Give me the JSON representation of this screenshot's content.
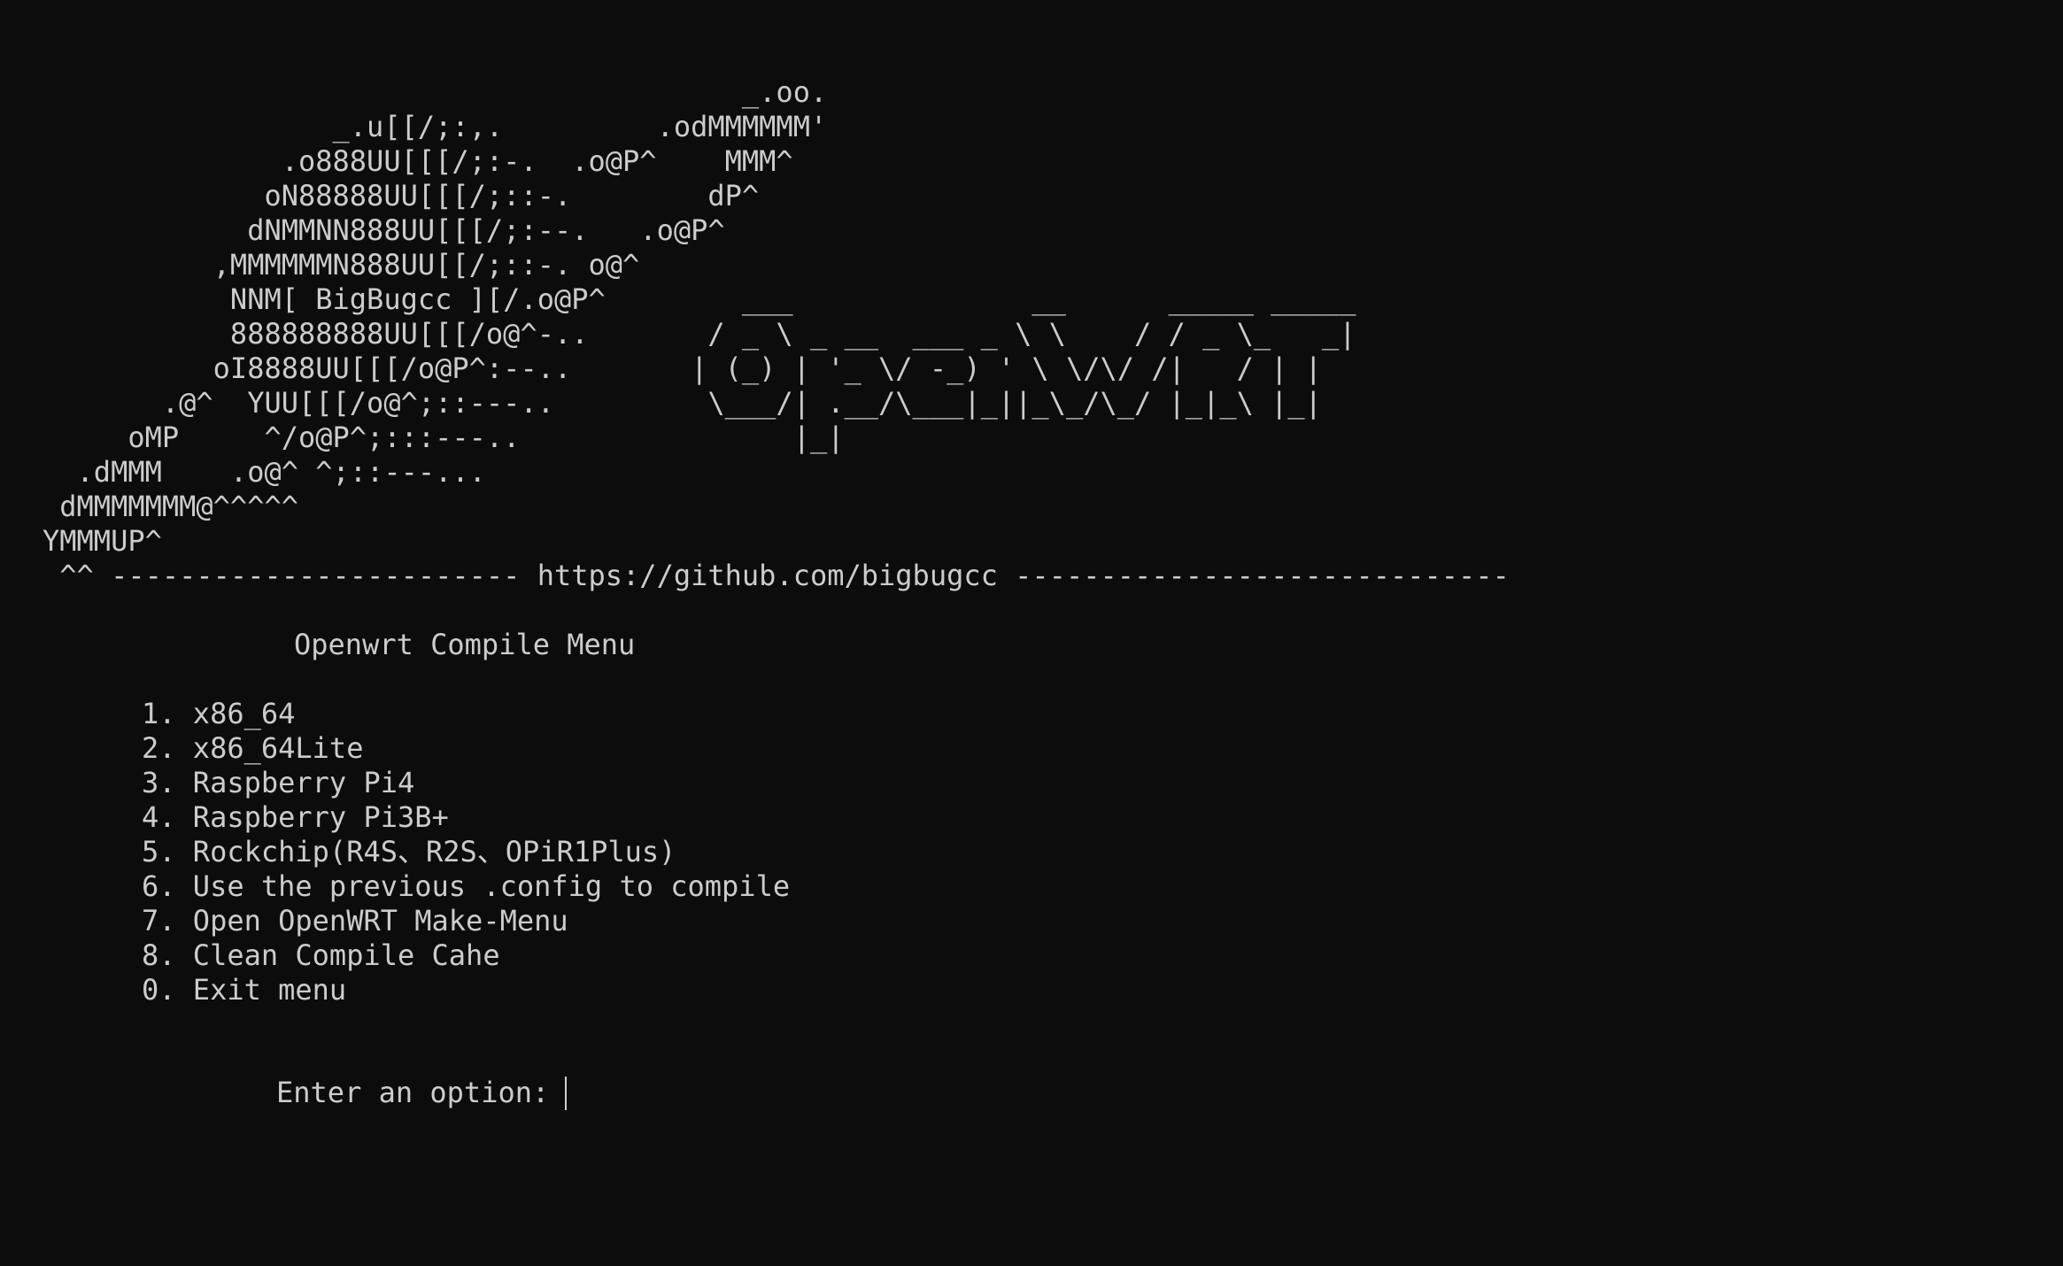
{
  "ascii_banner": [
    "                                         _.oo.",
    "                 _.u[[/;:,.         .odMMMMMM'",
    "              .o888UU[[[/;:-.  .o@P^    MMM^",
    "             oN88888UU[[[/;::-.        dP^",
    "            dNMMNN888UU[[[/;:--.   .o@P^",
    "          ,MMMMMMN888UU[[/;::-. o@^",
    "           NNM[ BigBugcc ][/.o@P^        ___              __      _____ _____",
    "           888888888UU[[[/o@^-..       / _ \\ _ __  ___ _ \\ \\    / / _ \\_   _|",
    "          oI8888UU[[[/o@P^:--..       | (_) | '_ \\/ -_) ' \\ \\/\\/ /|   / | |",
    "       .@^  YUU[[[/o@^;::---..         \\___/| .__/\\___|_||_\\_/\\_/ |_|_\\ |_|",
    "     oMP     ^/o@P^;:::---..                |_|",
    "  .dMMM    .o@^ ^;::---...",
    " dMMMMMMM@^^^^^",
    "YMMMUP^",
    " ^^ ------------------------ https://github.com/bigbugcc -----------------------------"
  ],
  "menu": {
    "title": "Openwrt Compile Menu",
    "items": [
      "1. x86_64",
      "2. x86_64Lite",
      "3. Raspberry Pi4",
      "4. Raspberry Pi3B+",
      "5. Rockchip(R4S、R2S、OPiR1Plus)",
      "6. Use the previous .config to compile",
      "7. Open OpenWRT Make-Menu",
      "8. Clean Compile Cahe",
      "0. Exit menu"
    ],
    "prompt": "Enter an option:"
  },
  "colors": {
    "background": "#0c0c0c",
    "foreground": "#cccccc"
  }
}
